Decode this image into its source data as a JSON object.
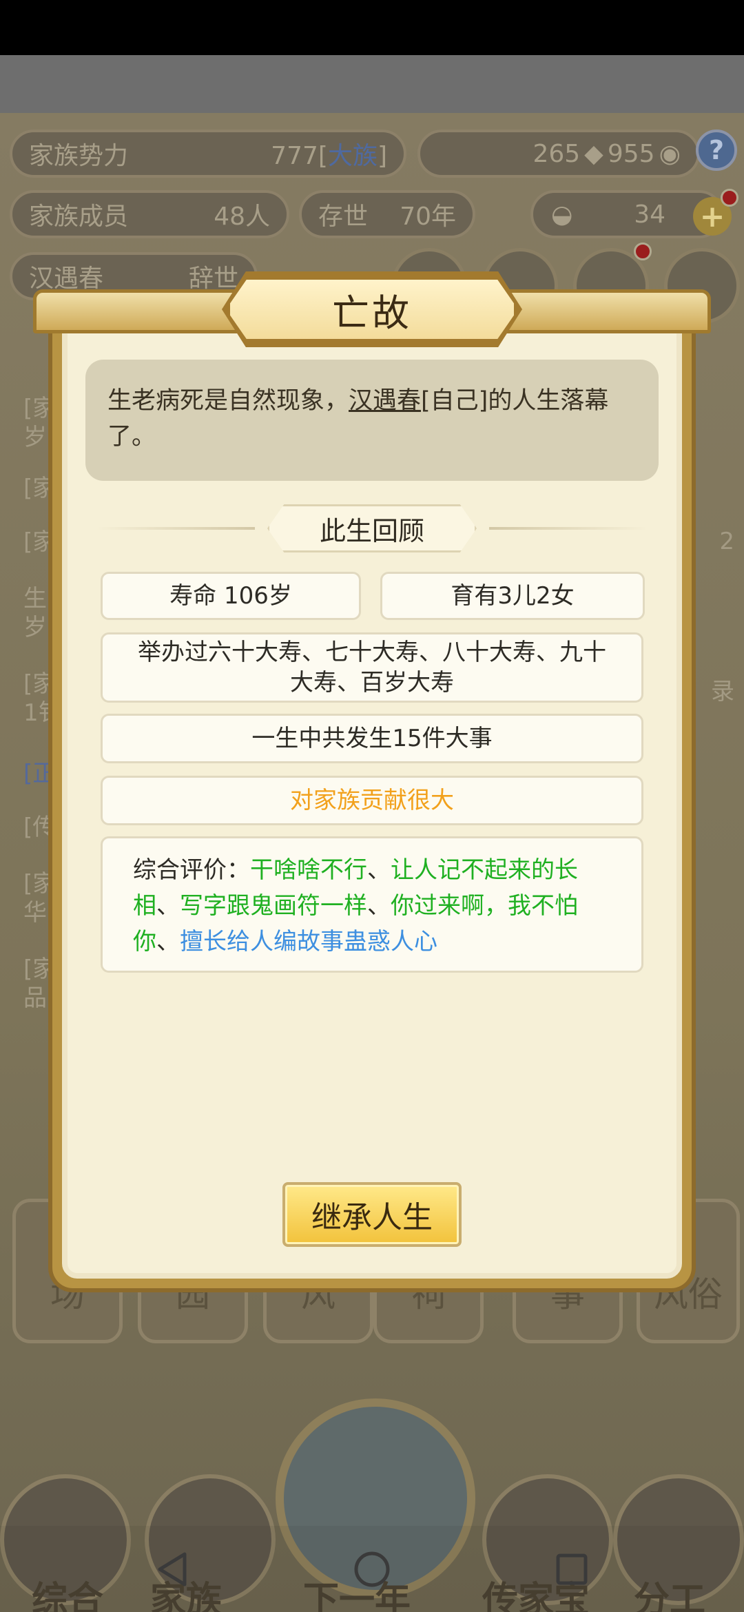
{
  "background": {
    "clan_power_label": "家族势力",
    "clan_power_value": "777",
    "clan_power_rank": "大族",
    "copper_value": "265",
    "coin_value": "955",
    "members_label": "家族成员",
    "members_value": "48人",
    "exist_label": "存世",
    "exist_value": "70年",
    "gold_value": "34",
    "person_name": "汉遇春",
    "person_status": "辞世",
    "tabs": [
      "场",
      "园",
      "风",
      "祠",
      "事",
      "风俗"
    ],
    "bottom_nav": [
      "综合",
      "家族",
      "下一年",
      "传家宝",
      "分工"
    ]
  },
  "dialog": {
    "title": "亡故",
    "message_prefix": "生老病死是自然现象，",
    "message_name": "汉遇春",
    "message_suffix": "[自己]的人生落幕了。",
    "review_title": "此生回顾",
    "lifespan": "寿命 106岁",
    "children": "育有3儿2女",
    "birthdays": "举办过六十大寿、七十大寿、八十大寿、九十大寿、百岁大寿",
    "events": "一生中共发生15件大事",
    "contribution": "对家族贡献很大",
    "evaluation_label": "综合评价：",
    "traits": [
      {
        "text": "干啥啥不行",
        "color": "#1fb021"
      },
      {
        "text": "让人记不起来的长相",
        "color": "#1fb021"
      },
      {
        "text": "写字跟鬼画符一样",
        "color": "#1fb021"
      },
      {
        "text": "你过来啊，我不怕你",
        "color": "#1fb021"
      },
      {
        "text": "擅长给人编故事蛊惑人心",
        "color": "#3d8fe0"
      }
    ],
    "inherit_button": "继承人生"
  }
}
